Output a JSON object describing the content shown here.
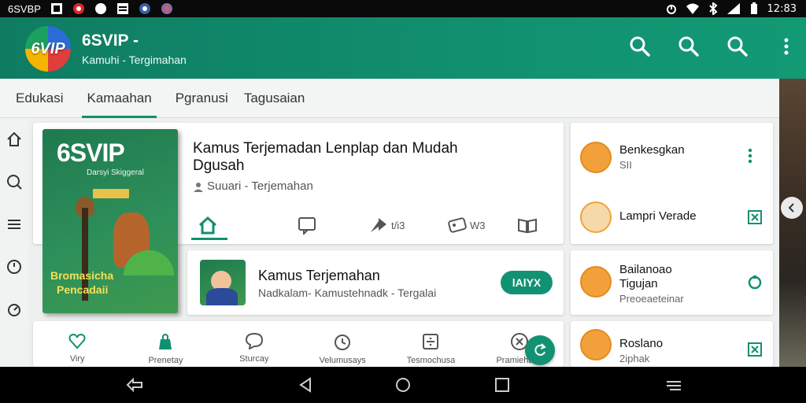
{
  "statusbar": {
    "left_label": "6SVBP",
    "time": "12:83"
  },
  "appbar": {
    "logo_text": "6VIP",
    "title": "6SVIP -",
    "subtitle": "Kamuhi - Tergimahan"
  },
  "tabs": [
    {
      "label": "Edukasi"
    },
    {
      "label": "Kamaahan",
      "active": true
    },
    {
      "label": "Pgranusi"
    },
    {
      "label": "Tagusaian"
    }
  ],
  "main_card": {
    "cover": {
      "title": "6SVIP",
      "subtitle": "Darsyi Skiggeral",
      "bottom_line1": "Bromasicha",
      "bottom_line2": "Pencadaii"
    },
    "title_line1": "Kamus Terjemadan Lenplap dan Mudah",
    "title_line2": "Dgusah",
    "subtitle": "Suuari - Terjemahan",
    "actions": [
      {
        "icon": "home-icon",
        "count": ""
      },
      {
        "icon": "comment-icon",
        "count": ""
      },
      {
        "icon": "share-icon",
        "count": "t/i3"
      },
      {
        "icon": "tag-icon",
        "count": "W3"
      },
      {
        "icon": "book-icon",
        "count": ""
      },
      {
        "icon": "more-icon",
        "count": ""
      }
    ]
  },
  "second_card": {
    "title": "Kamus Terjemahan",
    "subtitle": "Nadkalam- Kamustehnadk - Tergalai",
    "button": "lAlYX"
  },
  "bottom_nav": [
    {
      "label": "Viry",
      "icon": "heart-icon"
    },
    {
      "label": "Prenetay",
      "icon": "bag-icon"
    },
    {
      "label": "Sturcay",
      "icon": "chat-icon"
    },
    {
      "label": "Velumusays",
      "icon": "clock-icon"
    },
    {
      "label": "Tesmochusa",
      "icon": "calculator-icon"
    },
    {
      "label": "Pramiehaite",
      "icon": "close-circle-icon"
    }
  ],
  "right_list": [
    {
      "title": "Benkesgkan",
      "sub": "SII",
      "action": "more-icon"
    },
    {
      "title": "Lampri Verade",
      "sub": "",
      "action": "expand-icon"
    },
    {
      "title": "Bailanoao\nTigujan",
      "sub": "Preoeaeteinar",
      "action": "lock-icon"
    },
    {
      "title": "Roslano",
      "sub": "2iphak",
      "action": "expand-icon"
    }
  ],
  "colors": {
    "primary": "#11906f",
    "accent": "#139173",
    "avatar": "#f2a13a"
  }
}
